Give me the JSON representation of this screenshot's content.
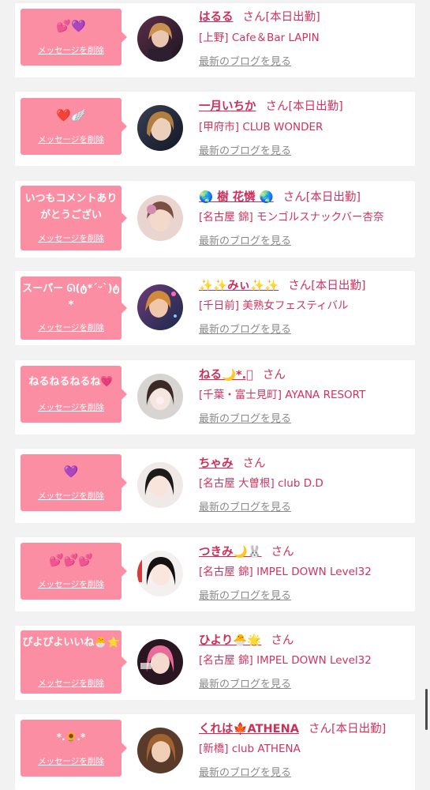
{
  "colors": {
    "bubble": "#fc8ea4",
    "name": "#cc2f5a",
    "shop": "#d0335e",
    "blog": "#8a8a8a"
  },
  "delete_label": "メッセージを削除",
  "san_label": "さん",
  "blog_label": "最新のブログを見る",
  "entries": [
    {
      "message": "💕💜",
      "name": "はるる",
      "status": "[本日出勤]",
      "shop": "[上野] Cafe＆Bar LAPIN",
      "show_blog": true
    },
    {
      "message": "❤️🪽",
      "name": "一月いちか",
      "status": "[本日出勤]",
      "shop": "[甲府市] CLUB WONDER",
      "show_blog": true
    },
    {
      "message": "いつもコメントありがとうござい",
      "name": "🌏 樹 花憐 🌏",
      "status": "[本日出勤]",
      "shop": "[名古屋 錦] モンゴルスナックバー杏奈",
      "show_blog": true
    },
    {
      "message": "スーパー ᘏ(ტ*ˊᵕˋ)ტ*",
      "name": "✨✨みぃ✨✨",
      "status": "[本日出勤]",
      "shop": "[千日前] 美熟女フェスティバル",
      "show_blog": true
    },
    {
      "message": "ねるねるねるね💗",
      "name": "ねる🌙*.ﾟ",
      "status": "",
      "shop": "[千葉・富士見町] AYANA RESORT",
      "show_blog": true
    },
    {
      "message": "💜",
      "name": "ちゃみ",
      "status": "",
      "shop": "[名古屋 大曽根] club D.D",
      "show_blog": true
    },
    {
      "message": "💕💕💕",
      "name": "つきみ🌙🐰",
      "status": "",
      "shop": "[名古屋 錦] IMPEL DOWN Level32",
      "show_blog": true
    },
    {
      "message": "ぴよぴよいいね🐣⭐️",
      "name": "ひより🐣🌟",
      "status": "",
      "shop": "[名古屋 錦] IMPEL DOWN Level32",
      "show_blog": true
    },
    {
      "message": "*.🌻.*",
      "name": "くれは🍁ATHENA",
      "status": "[本日出勤]",
      "shop": "[新橋] club ATHENA",
      "show_blog": true
    }
  ]
}
